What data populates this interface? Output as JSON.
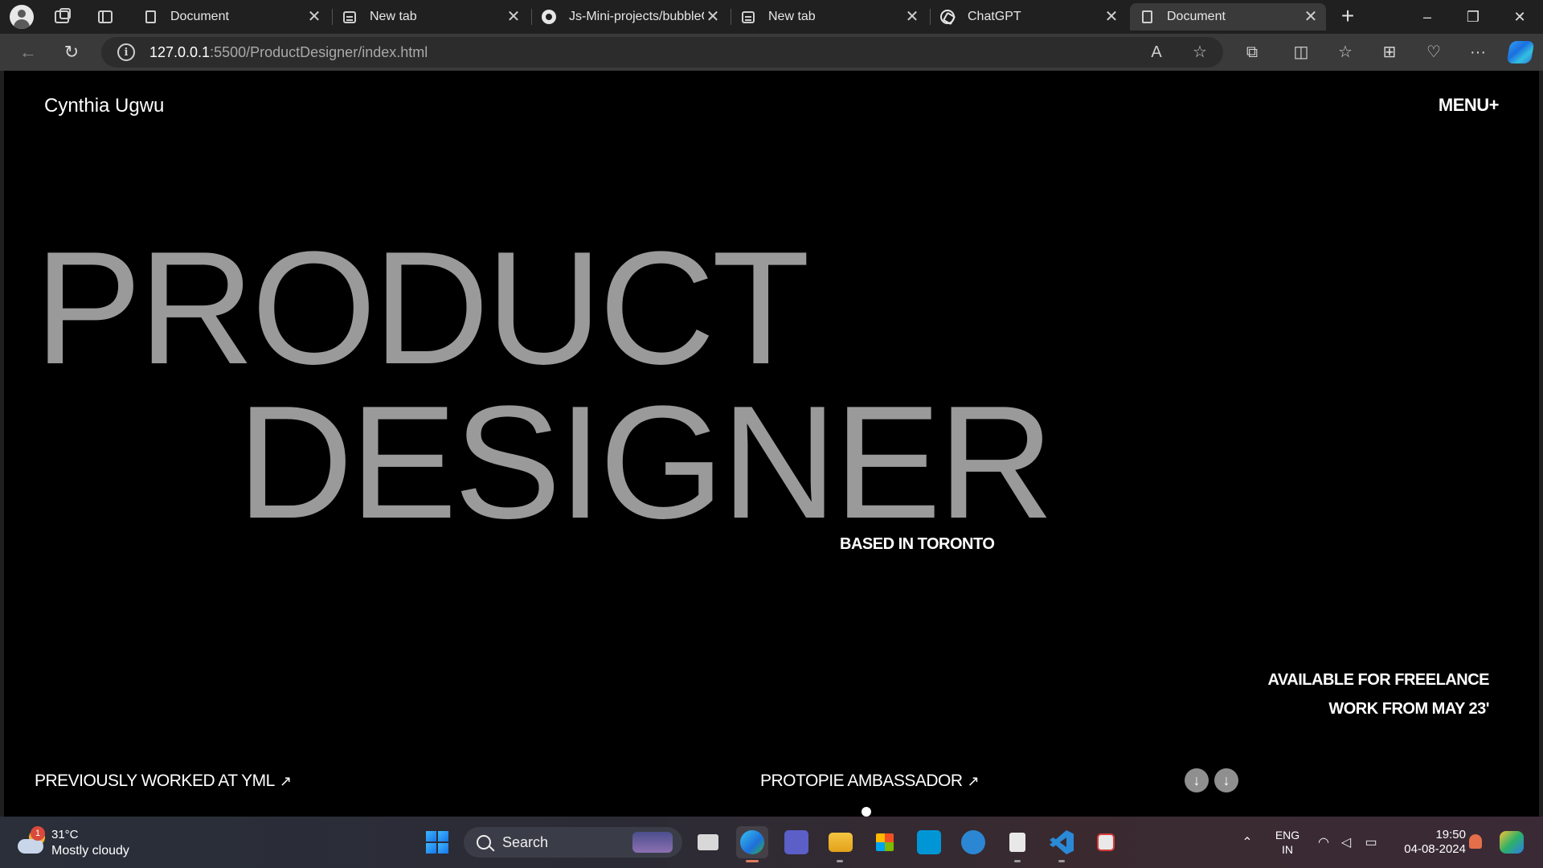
{
  "browser": {
    "tabs": [
      {
        "title": "Document",
        "favicon": "document-icon",
        "active": false
      },
      {
        "title": "New tab",
        "favicon": "new-tab-icon",
        "active": false
      },
      {
        "title": "Js-Mini-projects/bubbleGame",
        "favicon": "github-icon",
        "active": false
      },
      {
        "title": "New tab",
        "favicon": "new-tab-icon",
        "active": false
      },
      {
        "title": "ChatGPT",
        "favicon": "chatgpt-icon",
        "active": false
      },
      {
        "title": "Document",
        "favicon": "document-icon",
        "active": true
      }
    ],
    "url_host": "127.0.0.1",
    "url_path": ":5500/ProductDesigner/index.html"
  },
  "page": {
    "brand": "Cynthia Ugwu",
    "menu_label": "MENU+",
    "headline_line1": "PRODUCT",
    "headline_line2": "DESIGNER",
    "location": "BASED IN TORONTO",
    "availability_line1": "AVAILABLE FOR FREELANCE",
    "availability_line2": "WORK FROM MAY 23'",
    "link_previous": "PREVIOUSLY WORKED AT YML",
    "link_protopie": "PROTOPIE AMBASSADOR",
    "arrow_glyph": "↗",
    "down_glyph": "↓"
  },
  "taskbar": {
    "weather_badge": "1",
    "temperature": "31°C",
    "weather": "Mostly cloudy",
    "search_label": "Search",
    "lang_line1": "ENG",
    "lang_line2": "IN",
    "time": "19:50",
    "date": "04-08-2024"
  },
  "colors": {
    "page_background": "#000000",
    "headline": "#9a9a9a",
    "browser_chrome": "#202020",
    "toolbar": "#3a3a3a"
  }
}
